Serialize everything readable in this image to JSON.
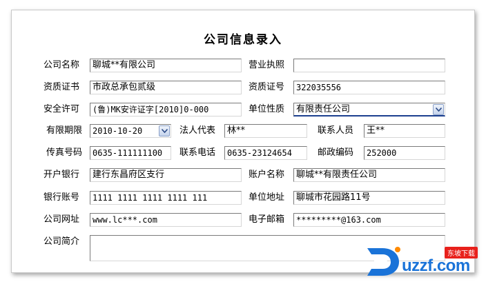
{
  "form": {
    "title": "公司信息录入",
    "labels": {
      "company_name": "公司名称",
      "business_license": "营业执照",
      "qualification_cert": "资质证书",
      "qualification_no": "资质证号",
      "safety_permit": "安全许可",
      "unit_nature": "单位性质",
      "valid_until": "有限期限",
      "legal_rep": "法人代表",
      "contact_person": "联系人员",
      "fax": "传真号码",
      "phone": "联系电话",
      "postal_code": "邮政编码",
      "bank": "开户银行",
      "account_name": "账户名称",
      "bank_account": "银行账号",
      "unit_address": "单位地址",
      "website": "公司网址",
      "email": "电子邮箱",
      "intro": "公司简介"
    },
    "values": {
      "company_name": "聊城**有限公司",
      "business_license": "",
      "qualification_cert": "市政总承包贰级",
      "qualification_no": "322035556",
      "safety_permit": "(鲁)MK安许证字[2010]0-000",
      "unit_nature": "有限责任公司",
      "valid_until": "2010-10-20",
      "legal_rep": "林**",
      "contact_person": "王**",
      "fax": "0635-111111100",
      "phone": "0635-23124654",
      "postal_code": "252000",
      "bank": "建行东昌府区支行",
      "account_name": "聊城**有限责任公司",
      "bank_account": "1111 1111 1111 1111 111",
      "unit_address": "聊城市花园路11号",
      "website": "www.lc***.com",
      "email": "*********@163.com",
      "intro": ""
    }
  },
  "watermark": {
    "brand": "uzzf.com",
    "badge": "东坡下载"
  },
  "colors": {
    "accent": "#1a73d8",
    "badge": "#e8211c"
  }
}
